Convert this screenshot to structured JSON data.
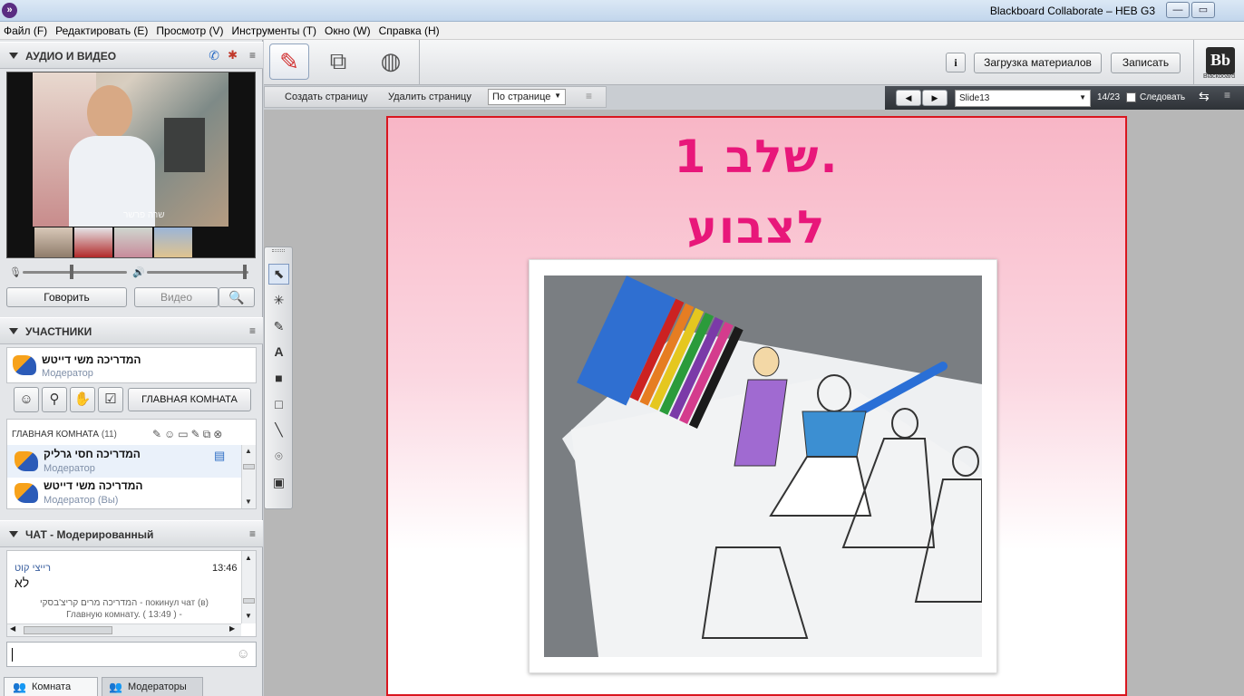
{
  "window": {
    "title": "Blackboard Collaborate – HEB G3",
    "controls": [
      "—",
      "▭"
    ]
  },
  "menu": [
    "Файл (F)",
    "Редактировать (E)",
    "Просмотр (V)",
    "Инструменты (T)",
    "Окно (W)",
    "Справка (H)"
  ],
  "av_panel": {
    "title": "АУДИО И ВИДЕО",
    "talk_label": "Говорить",
    "video_label": "Видео",
    "speaker_caption": "שרה פרשר",
    "mic_level": 0.47,
    "speaker_level": 0.98
  },
  "participants_panel": {
    "title": "УЧАСТНИКИ",
    "me": {
      "name": "המדריכה משי דייטש",
      "role": "Модератор"
    },
    "main_room_button": "ГЛАВНАЯ КОМНАТА",
    "room_label": "ГЛАВНАЯ КОМНАТА",
    "room_count": "(11)",
    "list": [
      {
        "name": "המדריכה חסי גרליק",
        "role": "Модератор"
      },
      {
        "name": "המדריכה משי דייטש",
        "role": "Модератор (Вы)"
      }
    ]
  },
  "chat_panel": {
    "title": "ЧАТ - Модерированный",
    "messages": [
      {
        "sender": "רייצי קוט",
        "time": "13:46",
        "text": "לא"
      }
    ],
    "system_line1": "המדריכה מרים קריצ'בסקי - покинул чат (в)",
    "system_line2": "Главную комнату. ( 13:49 ) -",
    "input_value": ""
  },
  "bottom_tabs": [
    "Комната",
    "Модераторы"
  ],
  "toolbar": {
    "upload_label": "Загрузка материалов",
    "record_label": "Записать",
    "logo_text": "Bb",
    "logo_sub": "Blackboard"
  },
  "page_controls": {
    "create_page": "Создать страницу",
    "delete_page": "Удалить страницу",
    "fit_mode": "По странице"
  },
  "slide_nav": {
    "slide_name": "Slide13",
    "counter": "14/23",
    "follow_label": "Следовать"
  },
  "slide": {
    "heading_line1": "שלב 1.",
    "heading_line2": "לצבוע",
    "heading_color": "#e8177a",
    "frame_color": "#d9161f"
  },
  "colors": {
    "accent": "#5a2d82",
    "slide_pink": "#f8b6c6"
  }
}
